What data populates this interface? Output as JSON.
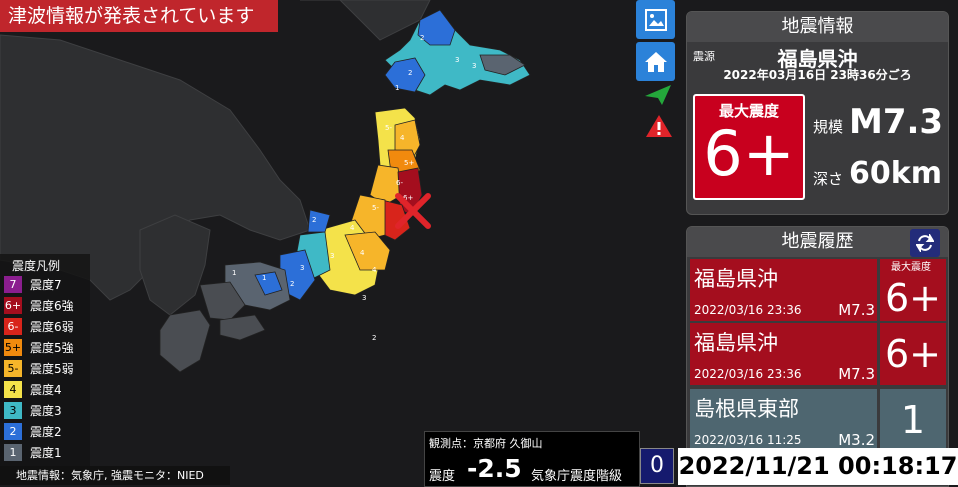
{
  "tsunami_banner": "津波情報が発表されています",
  "buttons": {
    "photo_icon": "image-icon",
    "home_icon": "home-icon",
    "plane_icon": "paper-plane-icon",
    "warning_icon": "warning-icon"
  },
  "eq_info": {
    "title": "地震情報",
    "epicenter_label": "震源",
    "epicenter": "福島県沖",
    "time": "2022年03月16日 23時36分ごろ",
    "max_intensity_label": "最大震度",
    "max_intensity": "6+",
    "magnitude_label": "規模",
    "magnitude": "M7.3",
    "depth_label": "深さ",
    "depth": "60km"
  },
  "history": {
    "title": "地震履歴",
    "max_col_label": "最大震度",
    "items": [
      {
        "name": "福島県沖",
        "time": "2022/03/16 23:36",
        "mag": "M7.3",
        "intensity": "6+"
      },
      {
        "name": "福島県沖",
        "time": "2022/03/16 23:36",
        "mag": "M7.3",
        "intensity": "6+"
      },
      {
        "name": "島根県東部",
        "time": "2022/03/16 11:25",
        "mag": "M3.2",
        "intensity": "1"
      }
    ]
  },
  "legend": {
    "title": "震度凡例",
    "items": [
      {
        "code": "7",
        "label": "震度7",
        "color": "#8b1e8f"
      },
      {
        "code": "6+",
        "label": "震度6強",
        "color": "#a40e1e"
      },
      {
        "code": "6-",
        "label": "震度6弱",
        "color": "#d8241b"
      },
      {
        "code": "5+",
        "label": "震度5強",
        "color": "#f18a0e"
      },
      {
        "code": "5-",
        "label": "震度5弱",
        "color": "#f6b52a"
      },
      {
        "code": "4",
        "label": "震度4",
        "color": "#f4e24a"
      },
      {
        "code": "3",
        "label": "震度3",
        "color": "#3fb9c6"
      },
      {
        "code": "2",
        "label": "震度2",
        "color": "#2c6fd8"
      },
      {
        "code": "1",
        "label": "震度1",
        "color": "#5a6470"
      }
    ]
  },
  "credit": "地震情報：気象庁, 強震モニタ：NIED",
  "observation": {
    "point": "観測点：京都府 久御山",
    "intensity_label": "震度",
    "intensity": "-2.5",
    "scale_label": "気象庁震度階級",
    "scale_value": "0"
  },
  "clock": "2022/11/21 00:18:17",
  "colors": {
    "panel": "#3a3a3c",
    "history_highlight": "#a40e1e",
    "history_gray": "#4e6670",
    "button": "#2b82d9"
  }
}
